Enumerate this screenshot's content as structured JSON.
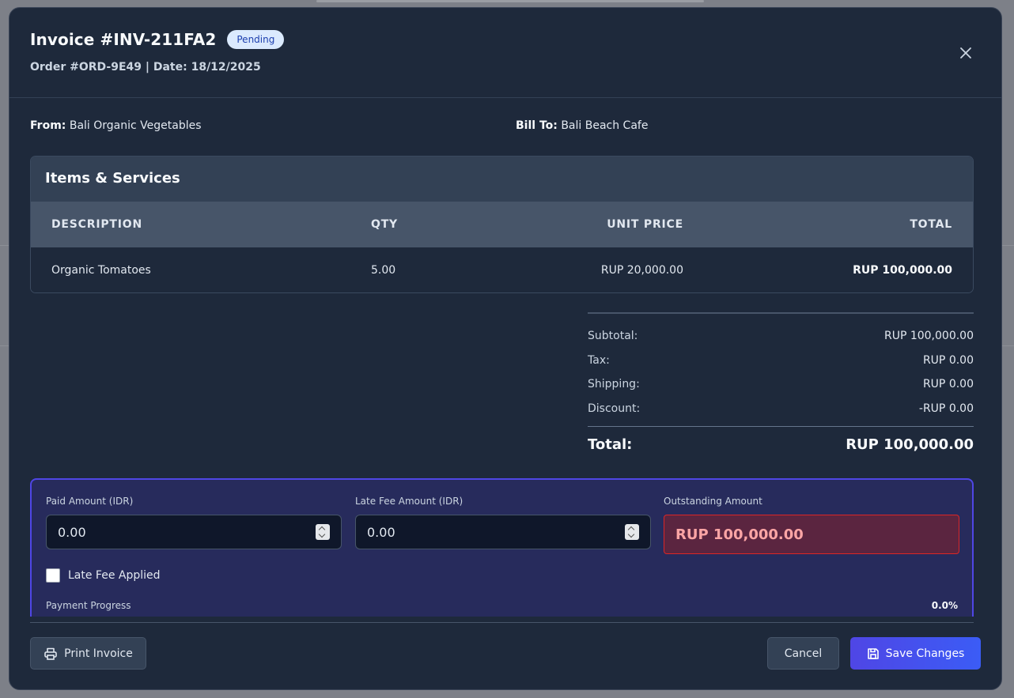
{
  "invoice": {
    "title": "Invoice #INV-211FA2",
    "status": "Pending",
    "subtitle": "Order #ORD-9E49 | Date: 18/12/2025"
  },
  "parties": {
    "from_label": "From:",
    "from_value": "Bali Organic Vegetables",
    "bill_to_label": "Bill To:",
    "bill_to_value": "Bali Beach Cafe"
  },
  "items": {
    "heading": "Items & Services",
    "columns": [
      "DESCRIPTION",
      "QTY",
      "UNIT PRICE",
      "TOTAL"
    ],
    "rows": [
      {
        "description": "Organic Tomatoes",
        "qty": "5.00",
        "unit_price": "RUP 20,000.00",
        "total": "RUP 100,000.00"
      }
    ]
  },
  "summary": {
    "subtotal_label": "Subtotal:",
    "subtotal": "RUP 100,000.00",
    "tax_label": "Tax:",
    "tax": "RUP 0.00",
    "shipping_label": "Shipping:",
    "shipping": "RUP 0.00",
    "discount_label": "Discount:",
    "discount": "-RUP 0.00",
    "total_label": "Total:",
    "total": "RUP 100,000.00"
  },
  "payment": {
    "paid_label": "Paid Amount (IDR)",
    "paid_value": "0.00",
    "late_fee_label": "Late Fee Amount (IDR)",
    "late_fee_value": "0.00",
    "outstanding_label": "Outstanding Amount",
    "outstanding_value": "RUP 100,000.00",
    "late_fee_applied_label": "Late Fee Applied",
    "progress_label": "Payment Progress",
    "progress_pct": "0.0%"
  },
  "footer": {
    "print_label": "Print Invoice",
    "cancel_label": "Cancel",
    "save_label": "Save Changes"
  },
  "colors": {
    "modal_bg": "#1e293b",
    "badge_bg": "#dbeafe",
    "accent": "#4f46e5",
    "outstanding_bg": "#5b2540",
    "outstanding_border": "#dc2626"
  }
}
